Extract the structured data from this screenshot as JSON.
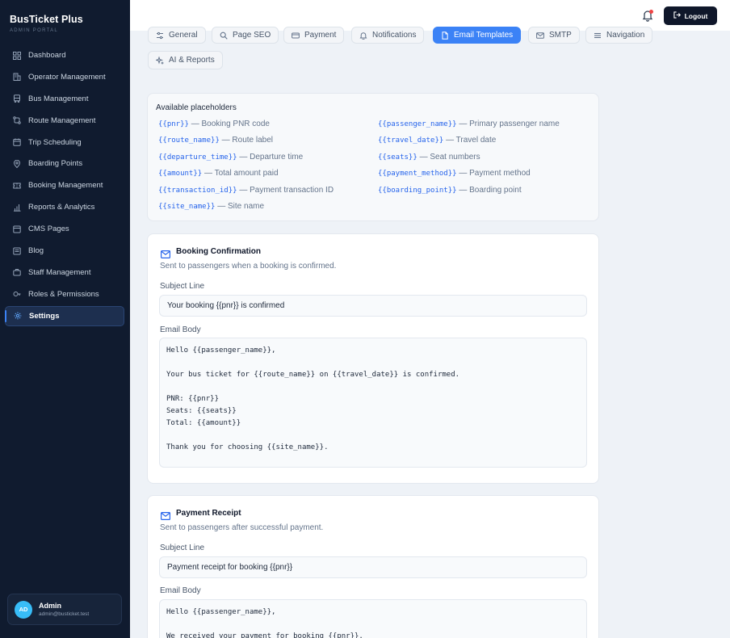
{
  "app": {
    "title": "BusTicket Plus",
    "subtitle": "ADMIN PORTAL"
  },
  "sidebar": {
    "items": [
      {
        "label": "Dashboard",
        "icon": "dashboard-icon"
      },
      {
        "label": "Operator Management",
        "icon": "building-icon"
      },
      {
        "label": "Bus Management",
        "icon": "bus-icon"
      },
      {
        "label": "Route Management",
        "icon": "route-icon"
      },
      {
        "label": "Trip Scheduling",
        "icon": "calendar-icon"
      },
      {
        "label": "Boarding Points",
        "icon": "map-pin-icon"
      },
      {
        "label": "Booking Management",
        "icon": "ticket-icon"
      },
      {
        "label": "Reports & Analytics",
        "icon": "chart-icon"
      },
      {
        "label": "CMS Pages",
        "icon": "file-icon"
      },
      {
        "label": "Blog",
        "icon": "blog-icon"
      },
      {
        "label": "Staff Management",
        "icon": "briefcase-icon"
      },
      {
        "label": "Roles & Permissions",
        "icon": "key-icon"
      },
      {
        "label": "Settings",
        "icon": "gear-icon",
        "active": true
      }
    ]
  },
  "user": {
    "initials": "AD",
    "name": "Admin",
    "email": "admin@busticket.test"
  },
  "topbar": {
    "logout_label": "Logout"
  },
  "tabs": [
    {
      "label": "General"
    },
    {
      "label": "Page SEO"
    },
    {
      "label": "Payment"
    },
    {
      "label": "Notifications"
    },
    {
      "label": "Email Templates",
      "active": true
    },
    {
      "label": "SMTP"
    },
    {
      "label": "Navigation"
    },
    {
      "label": "AI & Reports"
    }
  ],
  "placeholders": {
    "title": "Available placeholders",
    "items": [
      {
        "code": "{{pnr}}",
        "desc": "— Booking PNR code"
      },
      {
        "code": "{{passenger_name}}",
        "desc": "— Primary passenger name"
      },
      {
        "code": "{{route_name}}",
        "desc": "— Route label"
      },
      {
        "code": "{{travel_date}}",
        "desc": "— Travel date"
      },
      {
        "code": "{{departure_time}}",
        "desc": "— Departure time"
      },
      {
        "code": "{{seats}}",
        "desc": "— Seat numbers"
      },
      {
        "code": "{{amount}}",
        "desc": "— Total amount paid"
      },
      {
        "code": "{{payment_method}}",
        "desc": "— Payment method"
      },
      {
        "code": "{{transaction_id}}",
        "desc": "— Payment transaction ID"
      },
      {
        "code": "{{boarding_point}}",
        "desc": "— Boarding point"
      },
      {
        "code": "{{site_name}}",
        "desc": "— Site name"
      }
    ]
  },
  "templates": [
    {
      "title": "Booking Confirmation",
      "description": "Sent to passengers when a booking is confirmed.",
      "subject_label": "Subject Line",
      "subject": "Your booking {{pnr}} is confirmed",
      "body_label": "Email Body",
      "body": "Hello {{passenger_name}},\n\nYour bus ticket for {{route_name}} on {{travel_date}} is confirmed.\n\nPNR: {{pnr}}\nSeats: {{seats}}\nTotal: {{amount}}\n\nThank you for choosing {{site_name}}."
    },
    {
      "title": "Payment Receipt",
      "description": "Sent to passengers after successful payment.",
      "subject_label": "Subject Line",
      "subject": "Payment receipt for booking {{pnr}}",
      "body_label": "Email Body",
      "body": "Hello {{passenger_name}},\n\nWe received your payment for booking {{pnr}}."
    }
  ]
}
